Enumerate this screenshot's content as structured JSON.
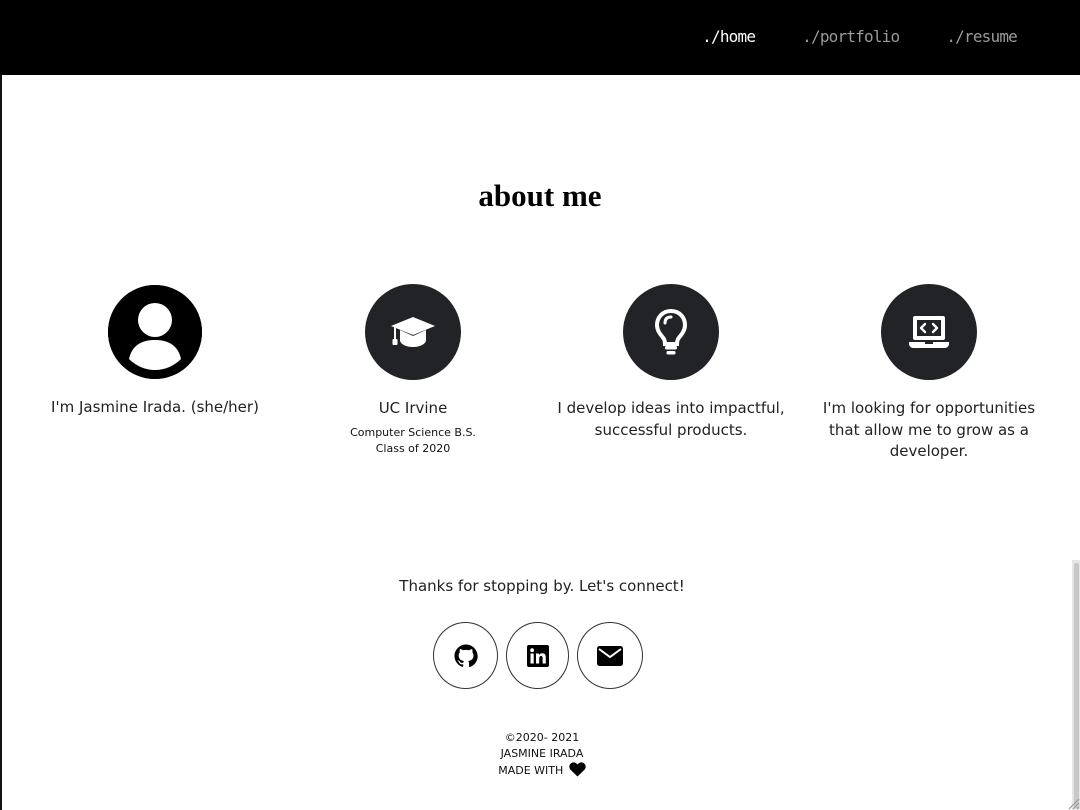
{
  "nav": {
    "links": [
      {
        "label": "./home",
        "active": true
      },
      {
        "label": "./portfolio",
        "active": false
      },
      {
        "label": "./resume",
        "active": false
      }
    ]
  },
  "about": {
    "title": "about me",
    "cards": [
      {
        "icon": "user-icon",
        "title": "I'm Jasmine Irada. (she/her)",
        "sub": []
      },
      {
        "icon": "graduation-cap-icon",
        "title": "UC Irvine",
        "sub": [
          "Computer Science B.S.",
          "Class of 2020"
        ]
      },
      {
        "icon": "lightbulb-icon",
        "title": "I develop ideas into impactful, successful products.",
        "sub": []
      },
      {
        "icon": "laptop-code-icon",
        "title": "I'm looking for opportunities that allow me to grow as a developer.",
        "sub": []
      }
    ]
  },
  "connect": {
    "text": "Thanks for stopping by. Let's connect!",
    "links": [
      {
        "icon": "github-icon"
      },
      {
        "icon": "linkedin-icon"
      },
      {
        "icon": "envelope-icon"
      }
    ]
  },
  "footer": {
    "copyright": "©2020- 2021",
    "name": "JASMINE IRADA",
    "made_with": "MADE WITH",
    "heart_icon": "heart-icon"
  },
  "colors": {
    "navbar": "#000000",
    "icon_circle": "#222326",
    "nav_active": "#ffffff",
    "nav_inactive": "#9a9a9a"
  }
}
